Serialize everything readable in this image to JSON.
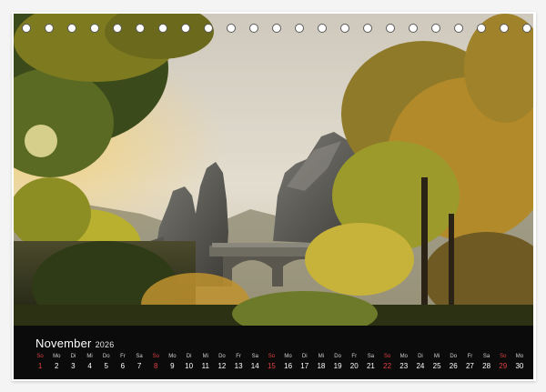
{
  "calendar": {
    "month": "November",
    "year": "2026",
    "accent_color": "#e14141",
    "days": [
      {
        "wd": "So",
        "num": "1",
        "sunday": true
      },
      {
        "wd": "Mo",
        "num": "2"
      },
      {
        "wd": "Di",
        "num": "3"
      },
      {
        "wd": "Mi",
        "num": "4"
      },
      {
        "wd": "Do",
        "num": "5"
      },
      {
        "wd": "Fr",
        "num": "6"
      },
      {
        "wd": "Sa",
        "num": "7"
      },
      {
        "wd": "So",
        "num": "8",
        "sunday": true
      },
      {
        "wd": "Mo",
        "num": "9"
      },
      {
        "wd": "Di",
        "num": "10"
      },
      {
        "wd": "Mi",
        "num": "11"
      },
      {
        "wd": "Do",
        "num": "12"
      },
      {
        "wd": "Fr",
        "num": "13"
      },
      {
        "wd": "Sa",
        "num": "14"
      },
      {
        "wd": "So",
        "num": "15",
        "sunday": true
      },
      {
        "wd": "Mo",
        "num": "16"
      },
      {
        "wd": "Di",
        "num": "17"
      },
      {
        "wd": "Mi",
        "num": "18"
      },
      {
        "wd": "Do",
        "num": "19"
      },
      {
        "wd": "Fr",
        "num": "20"
      },
      {
        "wd": "Sa",
        "num": "21"
      },
      {
        "wd": "So",
        "num": "22",
        "sunday": true
      },
      {
        "wd": "Mo",
        "num": "23"
      },
      {
        "wd": "Di",
        "num": "24"
      },
      {
        "wd": "Mi",
        "num": "25"
      },
      {
        "wd": "Do",
        "num": "26"
      },
      {
        "wd": "Fr",
        "num": "27"
      },
      {
        "wd": "Sa",
        "num": "28"
      },
      {
        "wd": "So",
        "num": "29",
        "sunday": true
      },
      {
        "wd": "Mo",
        "num": "30"
      }
    ]
  },
  "binding": {
    "ring_count": 23
  }
}
